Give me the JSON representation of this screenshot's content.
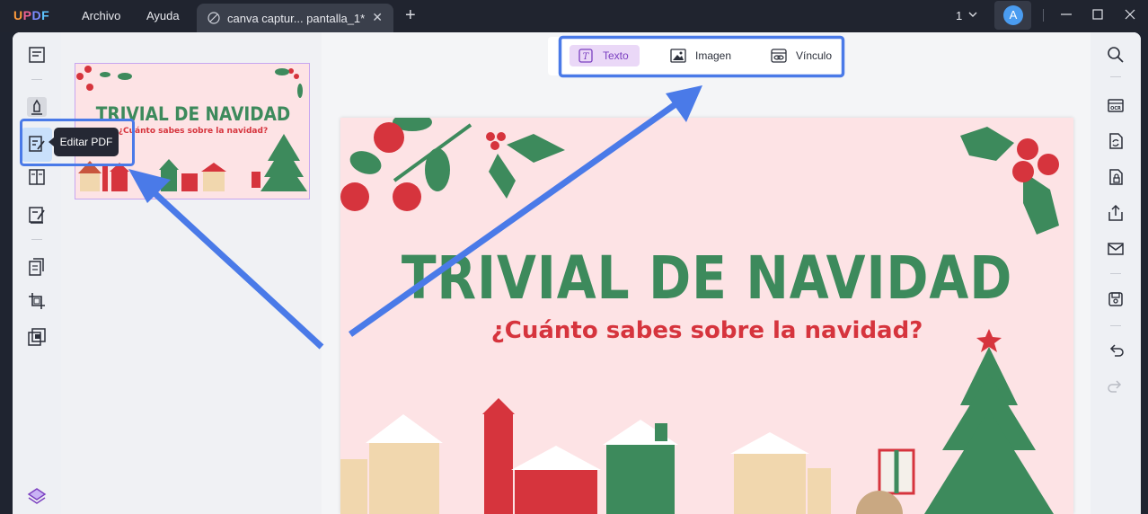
{
  "app": {
    "logo": "UPDF",
    "menu": [
      "Archivo",
      "Ayuda"
    ],
    "tab": {
      "title": "canva captur... pantalla_1*"
    },
    "page_indicator": "1",
    "avatar_initial": "A"
  },
  "left_toolbar": {
    "tooltip": "Editar PDF"
  },
  "edit_toolbar": {
    "items": [
      {
        "label": "Texto",
        "icon": "text-box-icon",
        "active": true
      },
      {
        "label": "Imagen",
        "icon": "image-icon",
        "active": false
      },
      {
        "label": "Vínculo",
        "icon": "link-icon",
        "active": false
      }
    ]
  },
  "document": {
    "title": "TRIVIAL DE NAVIDAD",
    "subtitle": "¿Cuánto sabes sobre la navidad?"
  },
  "colors": {
    "accent": "#7a3fc0",
    "highlight_annotation": "#4a7ae8",
    "page_background": "#fde3e5",
    "title_green": "#3d8a5c",
    "subtitle_red": "#d6343d"
  }
}
